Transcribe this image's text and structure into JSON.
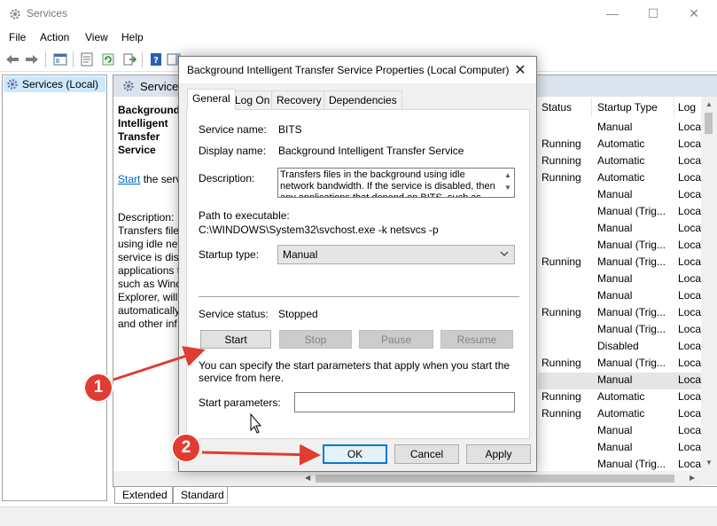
{
  "window": {
    "title": "Services",
    "minimize_glyph": "—",
    "maximize_glyph": "☐",
    "close_glyph": "✕"
  },
  "menu": [
    "File",
    "Action",
    "View",
    "Help"
  ],
  "tree": {
    "root_label": "Services (Local)"
  },
  "content_header": {
    "title": "Services"
  },
  "desc_panel": {
    "title": "Background Intelligent Transfer Service",
    "start_link": "Start",
    "start_suffix": "the serv",
    "description_label": "Description:",
    "lines": [
      "Transfers files",
      "using idle net",
      "service is disa",
      "applications t",
      "such as Wind",
      "Explorer, will",
      "automatically",
      "and other inf"
    ]
  },
  "columns": {
    "status": "Status",
    "startup": "Startup Type",
    "logon": "Log"
  },
  "rows": [
    {
      "status": "",
      "startup": "Manual",
      "logon": "Loca"
    },
    {
      "status": "Running",
      "startup": "Automatic",
      "logon": "Loca"
    },
    {
      "status": "Running",
      "startup": "Automatic",
      "logon": "Loca"
    },
    {
      "status": "Running",
      "startup": "Automatic",
      "logon": "Loca"
    },
    {
      "status": "",
      "startup": "Manual",
      "logon": "Loca"
    },
    {
      "status": "",
      "startup": "Manual (Trig...",
      "logon": "Loca"
    },
    {
      "status": "",
      "startup": "Manual",
      "logon": "Loca"
    },
    {
      "status": "",
      "startup": "Manual (Trig...",
      "logon": "Loca"
    },
    {
      "status": "Running",
      "startup": "Manual (Trig...",
      "logon": "Loca"
    },
    {
      "status": "",
      "startup": "Manual",
      "logon": "Loca"
    },
    {
      "status": "",
      "startup": "Manual",
      "logon": "Loca"
    },
    {
      "status": "Running",
      "startup": "Manual (Trig...",
      "logon": "Loca"
    },
    {
      "status": "",
      "startup": "Manual (Trig...",
      "logon": "Loca"
    },
    {
      "status": "",
      "startup": "Disabled",
      "logon": "Loca"
    },
    {
      "status": "Running",
      "startup": "Manual (Trig...",
      "logon": "Loca"
    },
    {
      "status": "",
      "startup": "Manual",
      "logon": "Loca"
    },
    {
      "status": "Running",
      "startup": "Automatic",
      "logon": "Loca"
    },
    {
      "status": "Running",
      "startup": "Automatic",
      "logon": "Loca"
    },
    {
      "status": "",
      "startup": "Manual",
      "logon": "Loca"
    },
    {
      "status": "",
      "startup": "Manual",
      "logon": "Loca"
    },
    {
      "status": "",
      "startup": "Manual (Trig...",
      "logon": "Loca"
    }
  ],
  "bottom_tabs": [
    "Extended",
    "Standard"
  ],
  "dialog": {
    "title": "Background Intelligent Transfer Service Properties (Local Computer)",
    "close_glyph": "✕",
    "tabs": [
      "General",
      "Log On",
      "Recovery",
      "Dependencies"
    ],
    "service_name_label": "Service name:",
    "service_name": "BITS",
    "display_name_label": "Display name:",
    "display_name": "Background Intelligent Transfer Service",
    "description_label": "Description:",
    "description": "Transfers files in the background using idle network bandwidth. If the service is disabled, then any applications that depend on BITS, such as Windows",
    "path_label": "Path to executable:",
    "path": "C:\\WINDOWS\\System32\\svchost.exe -k netsvcs -p",
    "startup_type_label": "Startup type:",
    "startup_type": "Manual",
    "service_status_label": "Service status:",
    "service_status": "Stopped",
    "buttons": {
      "start": "Start",
      "stop": "Stop",
      "pause": "Pause",
      "resume": "Resume"
    },
    "params_note": "You can specify the start parameters that apply when you start the service from here.",
    "start_params_label": "Start parameters:",
    "start_params_value": "",
    "ok": "OK",
    "cancel": "Cancel",
    "apply": "Apply"
  },
  "annotations": {
    "badge1": "1",
    "badge2": "2",
    "color": "#e03c31"
  }
}
